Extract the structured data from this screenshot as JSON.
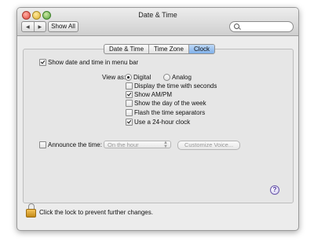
{
  "window": {
    "title": "Date & Time"
  },
  "toolbar": {
    "back_icon": "back-arrow",
    "forward_icon": "forward-arrow",
    "show_all_label": "Show All",
    "search_placeholder": ""
  },
  "tabs": [
    {
      "label": "Date & Time",
      "active": false
    },
    {
      "label": "Time Zone",
      "active": false
    },
    {
      "label": "Clock",
      "active": true
    }
  ],
  "clock": {
    "show_in_menu_bar": {
      "label": "Show date and time in menu bar",
      "checked": true
    },
    "view_as": {
      "label": "View as:",
      "options": [
        {
          "label": "Digital",
          "selected": true
        },
        {
          "label": "Analog",
          "selected": false
        }
      ]
    },
    "options": [
      {
        "label": "Display the time with seconds",
        "checked": false
      },
      {
        "label": "Show AM/PM",
        "checked": true
      },
      {
        "label": "Show the day of the week",
        "checked": false
      },
      {
        "label": "Flash the time separators",
        "checked": false
      },
      {
        "label": "Use a 24-hour clock",
        "checked": true
      }
    ],
    "announce": {
      "label": "Announce the time:",
      "checked": false,
      "interval_value": "On the hour",
      "customize_label": "Customize Voice..."
    }
  },
  "footer": {
    "lock_message": "Click the lock to prevent further changes."
  },
  "colors": {
    "active_tab": "#7fb0ea",
    "lock": "#e0a83a",
    "help": "#4a2f9b"
  }
}
